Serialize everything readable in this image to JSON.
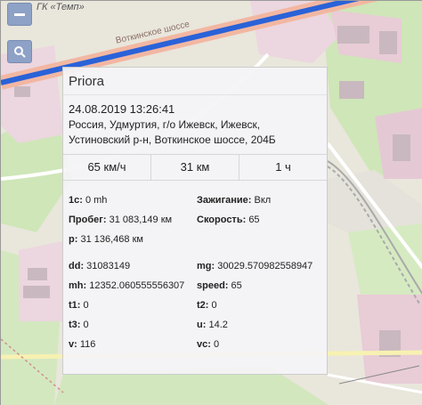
{
  "map": {
    "place_label": "ГК «Темп»",
    "street_label": "Воткинское шоссе",
    "zoom_out_icon": "minus-icon",
    "search_icon": "search-icon"
  },
  "popup": {
    "title": "Priora",
    "datetime": "24.08.2019 13:26:41",
    "address": "Россия, Удмуртия, г/о Ижевск, Ижевск, Устиновский р-н, Воткинское шоссе, 204Б",
    "stats": {
      "speed": "65 км/ч",
      "distance": "31 км",
      "duration": "1 ч"
    },
    "params_group1": [
      {
        "left_key": "1c:",
        "left_val": "0 mh",
        "right_key": "Зажигание:",
        "right_val": "Вкл"
      },
      {
        "left_key": "Пробег:",
        "left_val": "31 083,149 км",
        "right_key": "Скорость:",
        "right_val": "65"
      },
      {
        "left_key": "p:",
        "left_val": "31 136,468 км",
        "right_key": "",
        "right_val": ""
      }
    ],
    "params_group2": [
      {
        "left_key": "dd:",
        "left_val": "31083149",
        "right_key": "mg:",
        "right_val": "30029.570982558947"
      },
      {
        "left_key": "mh:",
        "left_val": "12352.060555556307",
        "right_key": "speed:",
        "right_val": "65"
      },
      {
        "left_key": "t1:",
        "left_val": "0",
        "right_key": "t2:",
        "right_val": "0"
      },
      {
        "left_key": "t3:",
        "left_val": "0",
        "right_key": "u:",
        "right_val": "14.2"
      },
      {
        "left_key": "v:",
        "left_val": "116",
        "right_key": "vc:",
        "right_val": "0"
      }
    ]
  }
}
